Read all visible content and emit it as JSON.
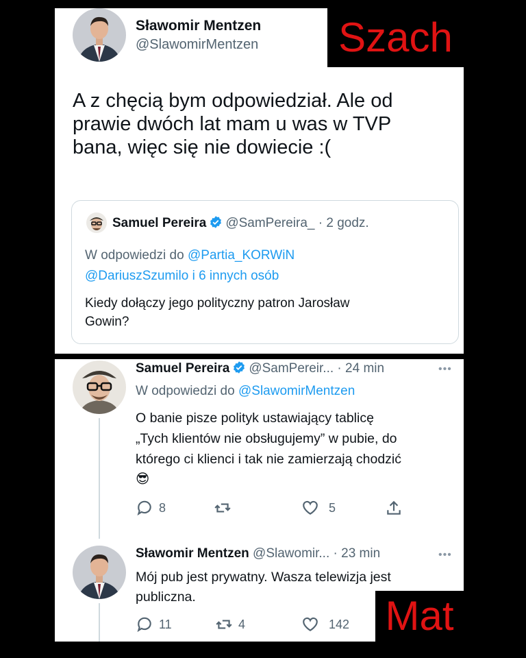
{
  "labels": {
    "top_right": "Szach",
    "bottom_right": "Mat"
  },
  "main_tweet": {
    "author_name": "Sławomir Mentzen",
    "author_handle": "@SlawomirMentzen",
    "text_lines": [
      "A z chęcią bym odpowiedział. Ale od",
      "prawie dwóch lat mam u was w TVP",
      "bana, więc się nie dowiecie :("
    ]
  },
  "quoted_tweet": {
    "author_name": "Samuel Pereira",
    "author_handle": "@SamPereira_",
    "time": "· 2 godz.",
    "reply_prefix": "W odpowiedzi do",
    "reply_to_1": "@Partia_KORWiN",
    "reply_to_2": "@DariuszSzumilo",
    "reply_suffix": "i 6 innych osób",
    "text_lines": [
      "Kiedy dołączy jego polityczny patron Jarosław",
      "Gowin?"
    ]
  },
  "reply_1": {
    "author_name": "Samuel Pereira",
    "author_handle": "@SamPereir...",
    "time": "· 24 min",
    "reply_prefix": "W odpowiedzi do",
    "reply_to": "@SlawomirMentzen",
    "text_lines": [
      "O banie pisze polityk ustawiający tablicę",
      "„Tych klientów nie obsługujemy” w pubie, do",
      "którego ci klienci i tak nie zamierzają chodzić"
    ],
    "emoji": "😎",
    "more": "•••",
    "actions": {
      "replies": "8",
      "retweets": "",
      "likes": "5"
    }
  },
  "reply_2": {
    "author_name": "Sławomir Mentzen",
    "author_handle": "@Slawomir...",
    "time": "· 23 min",
    "text_lines": [
      "Mój pub jest prywatny. Wasza telewizja jest",
      "publiczna."
    ],
    "more": "•••",
    "actions": {
      "replies": "11",
      "retweets": "4",
      "likes": "142"
    }
  },
  "colors": {
    "link": "#1d9bf0",
    "label_red": "#e01313",
    "text": "#0f1419",
    "muted": "#536471"
  }
}
